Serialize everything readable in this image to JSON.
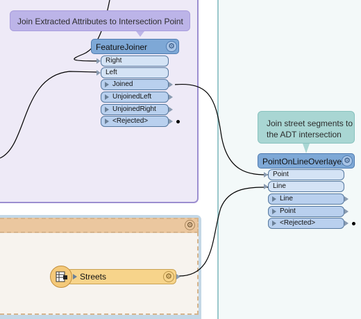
{
  "annotations": {
    "feature_joiner_note": "Join Extracted Attributes to Intersection Point",
    "point_on_line_note_line1": "Join street segments to",
    "point_on_line_note_line2": "the ADT intersection"
  },
  "feature_joiner": {
    "title": "FeatureJoiner",
    "inputs": [
      "Right",
      "Left"
    ],
    "outputs": [
      "Joined",
      "UnjoinedLeft",
      "UnjoinedRight",
      "<Rejected>"
    ]
  },
  "point_on_line_overlayer": {
    "title": "PointOnLineOverlayer",
    "inputs": [
      "Point",
      "Line"
    ],
    "outputs": [
      "Line",
      "Point",
      "<Rejected>"
    ]
  },
  "reader": {
    "label": "Streets"
  },
  "colors": {
    "transformer_header": "#7ea8d6",
    "port_fill": "#d4e3f5",
    "reader_fill": "#f7d48b",
    "bookmark_purple": "#eeeaf7",
    "bookmark_teal": "#f3f9f9",
    "bookmark_tan": "#ebc79f"
  }
}
